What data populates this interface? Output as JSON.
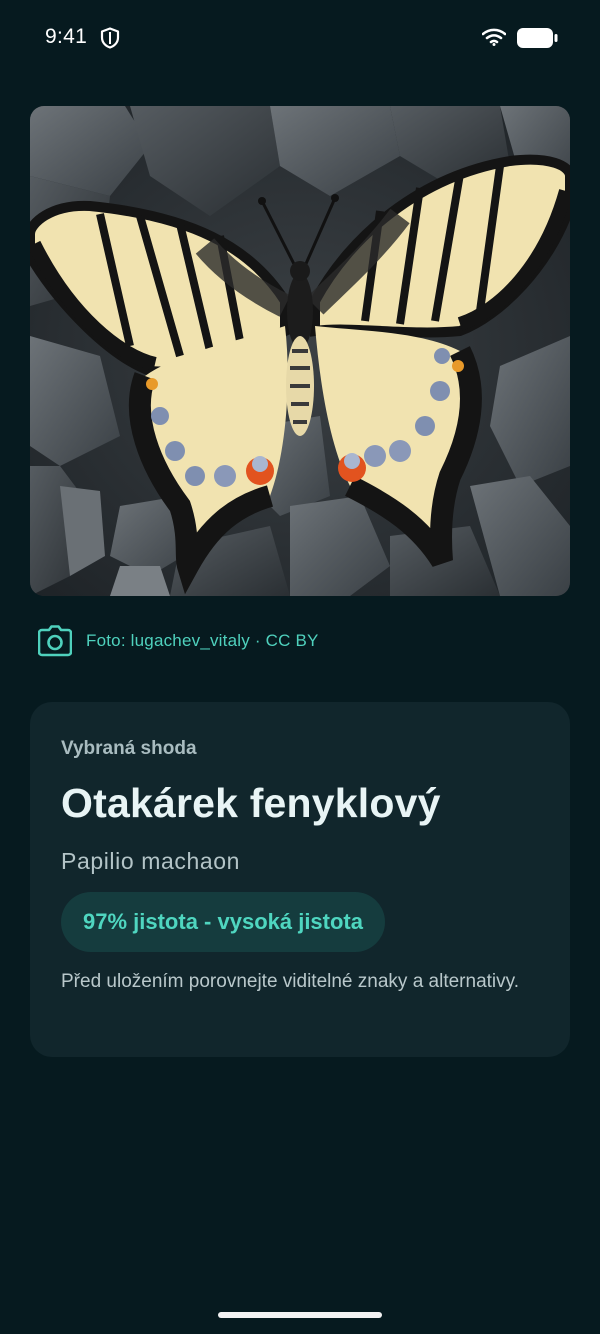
{
  "status_bar": {
    "time": "9:41",
    "icons": [
      "shield-icon",
      "wifi-icon",
      "battery-icon"
    ]
  },
  "photo": {
    "subject_icon": "swallowtail-butterfly-photo"
  },
  "credit": {
    "icon": "camera-icon",
    "text": "Foto: lugachev_vitaly · CC BY"
  },
  "result": {
    "label": "Vybraná shoda",
    "common_name": "Otakárek fenyklový",
    "latin_name": "Papilio machaon",
    "confidence": "97% jistota - vysoká jistota",
    "note": "Před uložením porovnejte viditelné znaky a alternativy."
  },
  "colors": {
    "background": "#061a1f",
    "card": "#11262c",
    "accent": "#4fd1bd",
    "chip": "#153c3e"
  }
}
